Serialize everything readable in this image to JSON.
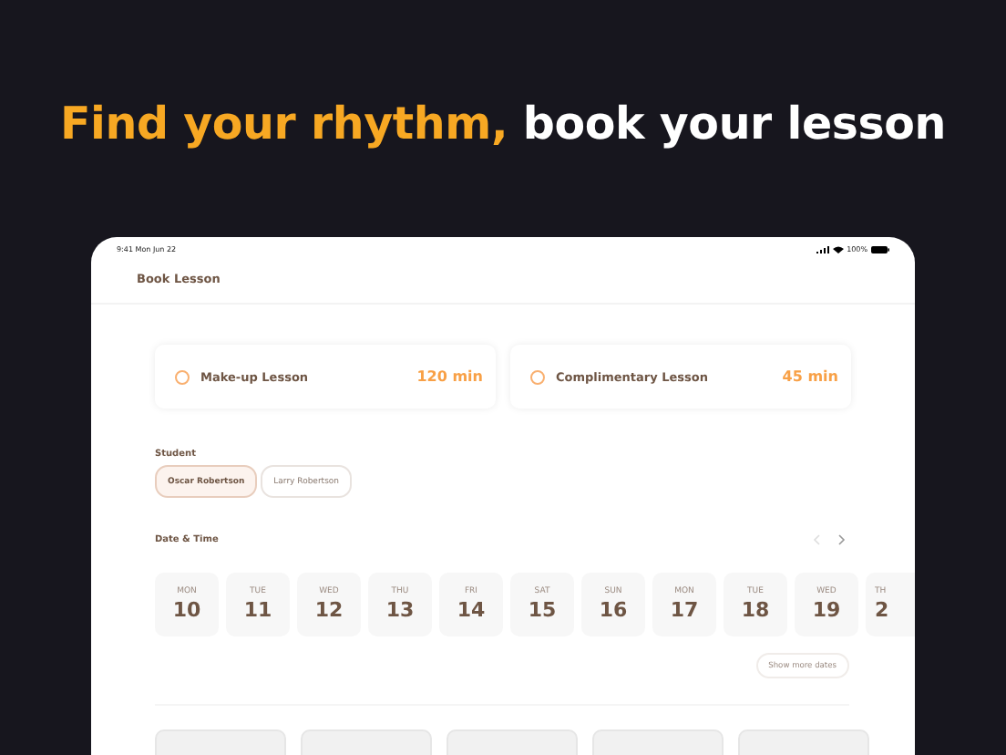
{
  "headline": {
    "accent": "Find your rhythm,",
    "rest": "book your lesson"
  },
  "status_bar": {
    "time": "9:41  Mon Jun 22",
    "battery": "100%"
  },
  "header": {
    "title": "Book Lesson"
  },
  "lessons": [
    {
      "name": "Make-up Lesson",
      "duration": "120 min",
      "selected": false
    },
    {
      "name": "Complimentary Lesson",
      "duration": "45 min",
      "selected": false
    }
  ],
  "student": {
    "label": "Student",
    "options": [
      {
        "name": "Oscar Robertson",
        "selected": true
      },
      {
        "name": "Larry Robertson",
        "selected": false
      }
    ]
  },
  "date_time": {
    "label": "Date & Time",
    "dates": [
      {
        "day": "MON",
        "date": "10"
      },
      {
        "day": "TUE",
        "date": "11"
      },
      {
        "day": "WED",
        "date": "12"
      },
      {
        "day": "THU",
        "date": "13"
      },
      {
        "day": "FRI",
        "date": "14"
      },
      {
        "day": "SAT",
        "date": "15"
      },
      {
        "day": "SUN",
        "date": "16"
      },
      {
        "day": "MON",
        "date": "17"
      },
      {
        "day": "TUE",
        "date": "18"
      },
      {
        "day": "WED",
        "date": "19"
      },
      {
        "day": "TH",
        "date": "2"
      }
    ],
    "more_button": "Show more dates"
  }
}
